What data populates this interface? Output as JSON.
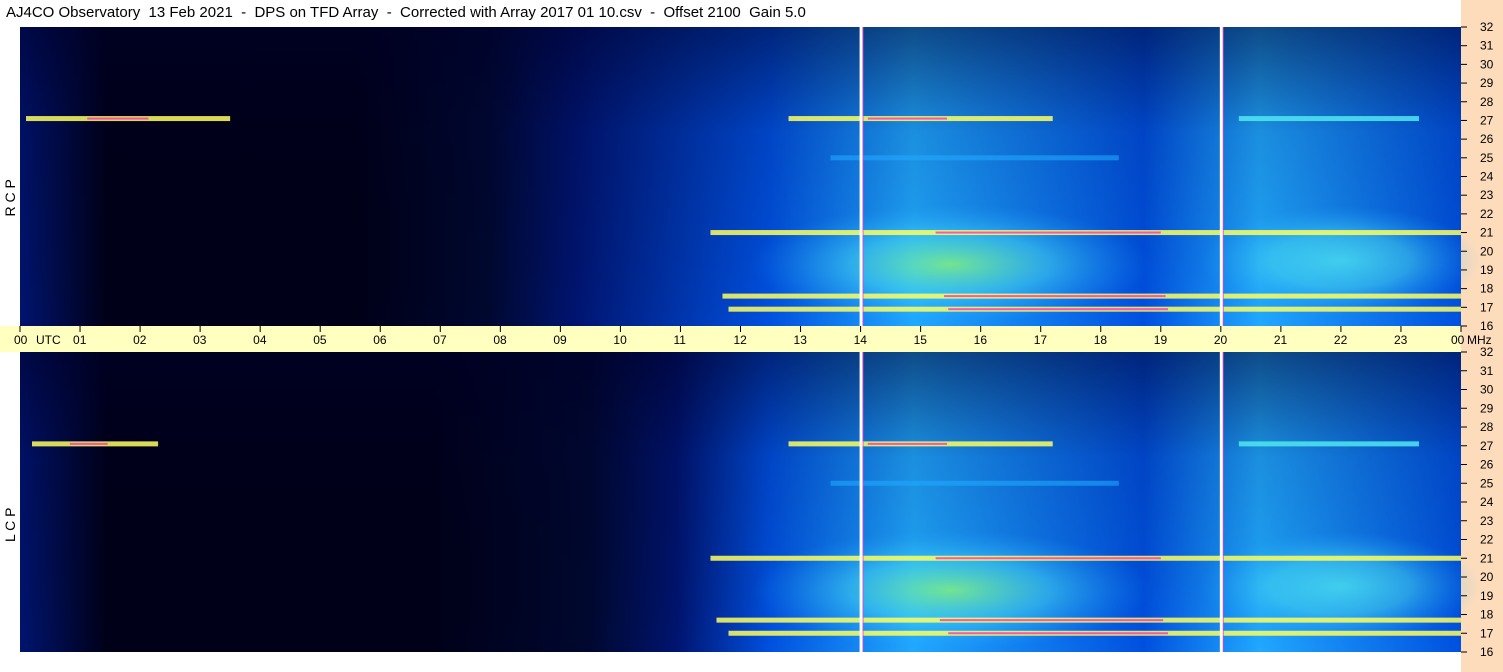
{
  "title": "AJ4CO Observatory  13 Feb 2021  -  DPS on TFD Array  -  Corrected with Array 2017 01 10.csv  -  Offset 2100  Gain 5.0",
  "colors": {
    "background": "#000018",
    "deep": "#001470",
    "mid": "#0050e0",
    "bright": "#20a8ff",
    "cyan": "#50e8f0",
    "green": "#90ff70",
    "yellow": "#ffff60",
    "magenta": "#ff30c0",
    "time_band": "#ffffc0",
    "freq_strip": "#fddcbc"
  },
  "time_axis": {
    "labels": [
      "00",
      "01",
      "02",
      "03",
      "04",
      "05",
      "06",
      "07",
      "08",
      "09",
      "10",
      "11",
      "12",
      "13",
      "14",
      "15",
      "16",
      "17",
      "18",
      "19",
      "20",
      "21",
      "22",
      "23",
      "00"
    ],
    "utc_label": "UTC",
    "unit": "MHz"
  },
  "chart_data": [
    {
      "type": "heatmap",
      "title": "",
      "panel": "RCP",
      "ylabel": "R C P",
      "xlabel": "UTC",
      "x_range_hours": [
        0,
        24
      ],
      "ylim_mhz": [
        16,
        32
      ],
      "y_ticks": [
        16,
        17,
        18,
        19,
        20,
        21,
        22,
        23,
        24,
        25,
        26,
        27,
        28,
        29,
        30,
        31,
        32
      ],
      "vertical_markers_utc": [
        14.0,
        20.0
      ],
      "features": [
        {
          "kind": "broadband_rise",
          "start_utc": 7.8,
          "end_utc": 24,
          "min_mhz": 16,
          "max_mhz": 32
        },
        {
          "kind": "band",
          "mhz": 27.1,
          "start_utc": 0.1,
          "end_utc": 3.5,
          "intensity": "high"
        },
        {
          "kind": "band",
          "mhz": 27.1,
          "start_utc": 12.8,
          "end_utc": 17.2,
          "intensity": "high"
        },
        {
          "kind": "band",
          "mhz": 27.1,
          "start_utc": 20.3,
          "end_utc": 23.3,
          "intensity": "medium"
        },
        {
          "kind": "band",
          "mhz": 21.0,
          "start_utc": 11.5,
          "end_utc": 24,
          "intensity": "high"
        },
        {
          "kind": "band",
          "mhz": 17.6,
          "start_utc": 11.7,
          "end_utc": 24,
          "intensity": "high"
        },
        {
          "kind": "band",
          "mhz": 16.9,
          "start_utc": 11.8,
          "end_utc": 24,
          "intensity": "high"
        },
        {
          "kind": "band",
          "mhz": 25.0,
          "start_utc": 13.5,
          "end_utc": 18.3,
          "intensity": "low"
        },
        {
          "kind": "blob",
          "center_utc": 15.5,
          "center_mhz": 19.3,
          "intensity": "high"
        },
        {
          "kind": "blob",
          "center_utc": 22.0,
          "center_mhz": 19.5,
          "intensity": "medium"
        }
      ]
    },
    {
      "type": "heatmap",
      "title": "",
      "panel": "LCP",
      "ylabel": "L C P",
      "xlabel": "UTC",
      "x_range_hours": [
        0,
        24
      ],
      "ylim_mhz": [
        16,
        32
      ],
      "y_ticks": [
        16,
        17,
        18,
        19,
        20,
        21,
        22,
        23,
        24,
        25,
        26,
        27,
        28,
        29,
        30,
        31,
        32
      ],
      "vertical_markers_utc": [
        14.0,
        20.0
      ],
      "features": [
        {
          "kind": "broadband_rise",
          "start_utc": 9.5,
          "end_utc": 24,
          "min_mhz": 16,
          "max_mhz": 32
        },
        {
          "kind": "band",
          "mhz": 27.1,
          "start_utc": 0.2,
          "end_utc": 2.3,
          "intensity": "high"
        },
        {
          "kind": "band",
          "mhz": 27.1,
          "start_utc": 12.8,
          "end_utc": 17.2,
          "intensity": "high"
        },
        {
          "kind": "band",
          "mhz": 27.1,
          "start_utc": 20.3,
          "end_utc": 23.3,
          "intensity": "medium"
        },
        {
          "kind": "band",
          "mhz": 21.0,
          "start_utc": 11.5,
          "end_utc": 24,
          "intensity": "high"
        },
        {
          "kind": "band",
          "mhz": 17.7,
          "start_utc": 11.6,
          "end_utc": 24,
          "intensity": "high"
        },
        {
          "kind": "band",
          "mhz": 17.0,
          "start_utc": 11.8,
          "end_utc": 24,
          "intensity": "high"
        },
        {
          "kind": "band",
          "mhz": 25.0,
          "start_utc": 13.5,
          "end_utc": 18.3,
          "intensity": "low"
        },
        {
          "kind": "blob",
          "center_utc": 15.5,
          "center_mhz": 19.3,
          "intensity": "high"
        },
        {
          "kind": "blob",
          "center_utc": 22.0,
          "center_mhz": 19.5,
          "intensity": "medium"
        }
      ]
    }
  ]
}
